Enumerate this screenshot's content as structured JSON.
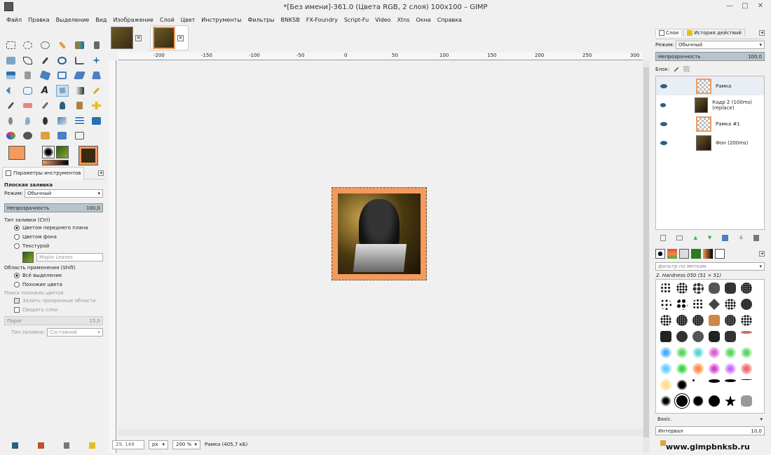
{
  "window": {
    "title": "*[Без имени]-361.0 (Цвета RGB, 2 слоя) 100x100 – GIMP",
    "minimize": "—",
    "maximize": "□",
    "close": "✕"
  },
  "menu": [
    "Файл",
    "Правка",
    "Выделение",
    "Вид",
    "Изображение",
    "Слой",
    "Цвет",
    "Инструменты",
    "Фильтры",
    "BNKSB",
    "FX-Foundry",
    "Script-Fu",
    "Video",
    "Xtns",
    "Окна",
    "Справка"
  ],
  "tool_options": {
    "tab": "Параметры инструментов",
    "title": "Плоская заливка",
    "mode_label": "Режим:",
    "mode_value": "Обычный",
    "opacity_label": "Непрозрачность",
    "opacity_value": "100,0",
    "fill_type_label": "Тип заливки (Ctrl)",
    "fill_fg": "Цветом переднего плана",
    "fill_bg": "Цветом фона",
    "fill_texture": "Текстурой",
    "pattern_name": "Maple Leaves",
    "area_label": "Область применения (Shift)",
    "area_all": "Всё выделение",
    "area_similar": "Похожие цвета",
    "similar_label": "Поиск похожих цветов",
    "fill_transparent": "Залить прозрачные области",
    "merge_layers": "Сводить слои",
    "threshold_label": "Порог",
    "threshold_value": "15,0",
    "fill_by_label": "Тип заливки:",
    "fill_by_value": "Составной"
  },
  "ruler": [
    "-200",
    "-150",
    "-100",
    "-50",
    "0",
    "50",
    "100",
    "150",
    "200",
    "250",
    "300"
  ],
  "status": {
    "coords": "29, 149",
    "unit": "px",
    "zoom": "200 %",
    "info": "Рамка (405,7 кБ)"
  },
  "layers_panel": {
    "tab_layers": "Слои",
    "tab_history": "История действий",
    "mode_label": "Режим:",
    "mode_value": "Обычный",
    "opacity_label": "Непрозрачность",
    "opacity_value": "100,0",
    "lock_label": "Блок:",
    "layers": [
      {
        "name": "Рамка"
      },
      {
        "name": "Кадр 2  (100ms)(replace)"
      },
      {
        "name": "Рамка #1"
      },
      {
        "name": "Фон (200ms)"
      }
    ]
  },
  "brushes_panel": {
    "filter_placeholder": "фильтр по меткам",
    "brush_name": "2. Hardness 050 (51 × 51)",
    "preset": "Basic.",
    "spacing_label": "Интервал",
    "spacing_value": "10,0"
  },
  "colors": {
    "fg": "#f39a5c",
    "bg": "#000000",
    "accent": "#7aa5c6"
  },
  "watermark": "www.gimpbnksb.ru"
}
